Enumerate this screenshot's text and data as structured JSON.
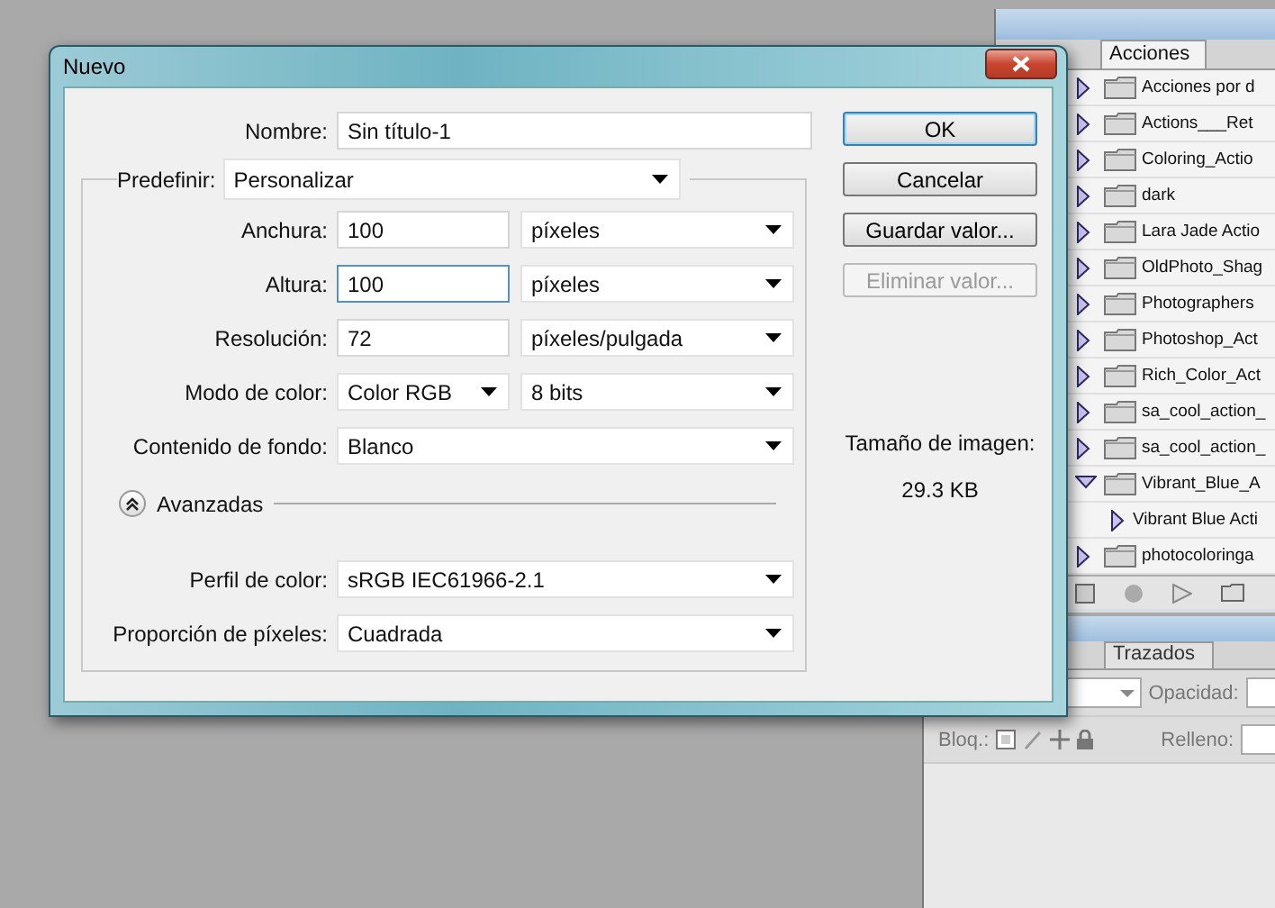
{
  "dialog": {
    "title": "Nuevo",
    "name": {
      "label": "Nombre:",
      "value": "Sin título-1"
    },
    "preset": {
      "label": "Predefinir:",
      "value": "Personalizar"
    },
    "rows": [
      {
        "label": "Anchura:",
        "value": "100",
        "focused": false,
        "unit": "píxeles"
      },
      {
        "label": "Altura:",
        "value": "100",
        "focused": true,
        "unit": "píxeles"
      },
      {
        "label": "Resolución:",
        "value": "72",
        "focused": false,
        "unit": "píxeles/pulgada"
      }
    ],
    "color_mode": {
      "label": "Modo de color:",
      "mode": "Color RGB",
      "depth": "8 bits"
    },
    "background": {
      "label": "Contenido de fondo:",
      "value": "Blanco"
    },
    "advanced": {
      "label": "Avanzadas",
      "expanded": true
    },
    "advanced_rows": [
      {
        "label": "Perfil de color:",
        "value": "sRGB IEC61966-2.1"
      },
      {
        "label": "Proporción de píxeles:",
        "value": "Cuadrada"
      }
    ],
    "buttons": [
      {
        "label": "OK",
        "default": true,
        "disabled": false
      },
      {
        "label": "Cancelar",
        "default": false,
        "disabled": false
      },
      {
        "label": "Guardar valor...",
        "default": false,
        "disabled": false
      },
      {
        "label": "Eliminar valor...",
        "default": false,
        "disabled": true
      }
    ],
    "image_size": {
      "label": "Tamaño de imagen:",
      "value": "29.3 KB"
    }
  },
  "actions_panel": {
    "tab": "Acciones",
    "items": [
      {
        "label": "Acciones por d",
        "expanded": false
      },
      {
        "label": "Actions___Ret",
        "expanded": false
      },
      {
        "label": "Coloring_Actio",
        "expanded": false
      },
      {
        "label": "dark",
        "expanded": false
      },
      {
        "label": "Lara Jade Actio",
        "expanded": false
      },
      {
        "label": "OldPhoto_Shag",
        "expanded": false
      },
      {
        "label": "Photographers",
        "expanded": false
      },
      {
        "label": "Photoshop_Act",
        "expanded": false
      },
      {
        "label": "Rich_Color_Act",
        "expanded": false
      },
      {
        "label": "sa_cool_action_",
        "expanded": false
      },
      {
        "label": "sa_cool_action_",
        "expanded": false
      },
      {
        "label": "Vibrant_Blue_A",
        "expanded": true,
        "children": [
          {
            "label": "Vibrant Blue Acti"
          }
        ]
      },
      {
        "label": "photocoloringa",
        "expanded": false
      }
    ]
  },
  "layers_panel": {
    "tab": "Trazados",
    "opacity_label": "Opacidad:",
    "lock_label": "Bloq.:",
    "fill_label": "Relleno:"
  }
}
